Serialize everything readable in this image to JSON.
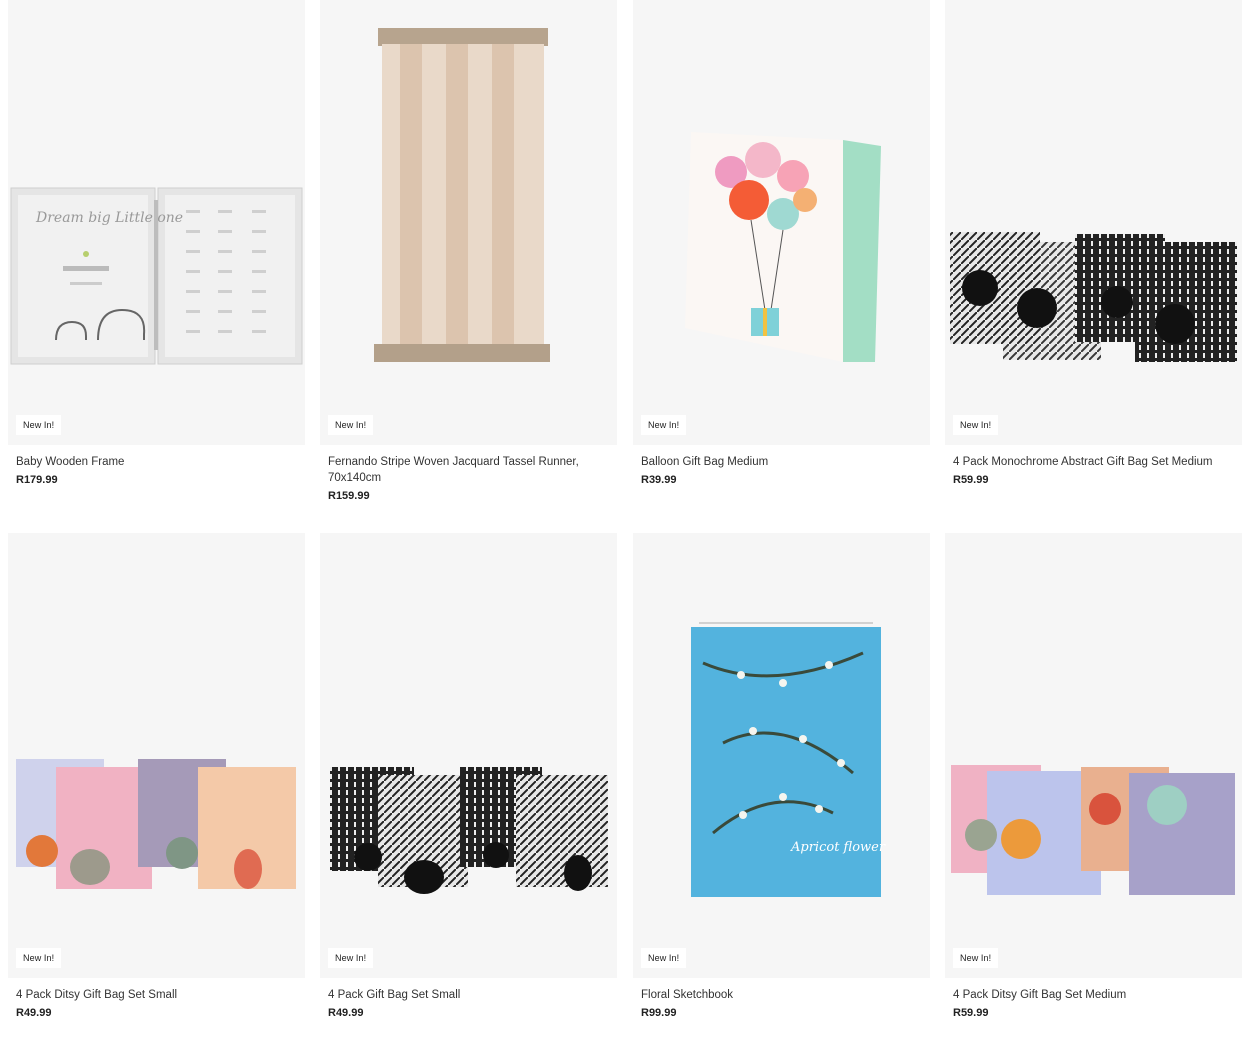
{
  "products": [
    {
      "title": "Baby Wooden Frame",
      "price": "R179.99",
      "badge": "New In!",
      "image": "photo-frame-image",
      "frame_text": "Dream big Little one"
    },
    {
      "title": "Fernando Stripe Woven Jacquard Tassel Runner, 70x140cm",
      "price": "R159.99",
      "badge": "New In!",
      "image": "tassel-runner-image"
    },
    {
      "title": "Balloon Gift Bag Medium",
      "price": "R39.99",
      "badge": "New In!",
      "image": "balloon-gift-bag-image"
    },
    {
      "title": "4 Pack Monochrome Abstract Gift Bag Set Medium",
      "price": "R59.99",
      "badge": "New In!",
      "image": "monochrome-gift-bags-image"
    },
    {
      "title": "4 Pack Ditsy Gift Bag Set Small",
      "price": "R49.99",
      "badge": "New In!",
      "image": "ditsy-gift-bags-small-image"
    },
    {
      "title": "4 Pack Gift Bag Set Small",
      "price": "R49.99",
      "badge": "New In!",
      "image": "gift-bag-set-small-image"
    },
    {
      "title": "Floral Sketchbook",
      "price": "R99.99",
      "badge": "New In!",
      "image": "floral-sketchbook-image",
      "cover_text": "Apricot flower"
    },
    {
      "title": "4 Pack Ditsy Gift Bag Set Medium",
      "price": "R59.99",
      "badge": "New In!",
      "image": "ditsy-gift-bags-medium-image"
    }
  ]
}
